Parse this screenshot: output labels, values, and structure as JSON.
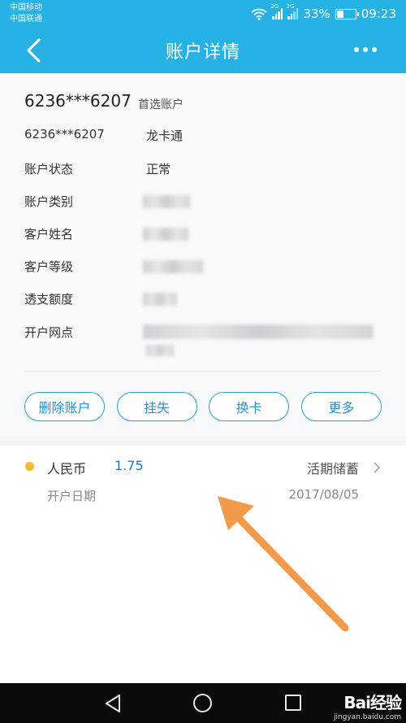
{
  "status_bar": {
    "carrier1": "中国移动",
    "carrier2": "中国联通",
    "net1": "2G",
    "net2": "2G",
    "battery": "33%",
    "time": "09:23"
  },
  "header": {
    "title": "账户详情"
  },
  "account": {
    "number": "6236***6207",
    "badge": "首选账户",
    "rows": [
      {
        "label": "6236***6207",
        "value": "龙卡通"
      },
      {
        "label": "账户状态",
        "value": "正常"
      },
      {
        "label": "账户类别",
        "value": ""
      },
      {
        "label": "客户姓名",
        "value": ""
      },
      {
        "label": "客户等级",
        "value": ""
      },
      {
        "label": "透支额度",
        "value": ""
      },
      {
        "label": "开户网点",
        "value": ""
      }
    ],
    "buttons": [
      "删除账户",
      "挂失",
      "换卡",
      "更多"
    ]
  },
  "currency": {
    "name": "人民币",
    "amount": "1.75",
    "type": "活期储蓄",
    "open_label": "开户日期",
    "open_date": "2017/08/05"
  },
  "watermark": {
    "brand": "Bai经验",
    "url": "jingyan.baidu.com"
  },
  "colors": {
    "primary": "#27b2e6",
    "button": "#2aa3dc",
    "amount": "#1f79b8",
    "dot": "#f3b92f",
    "arrow": "#f39a4a"
  }
}
